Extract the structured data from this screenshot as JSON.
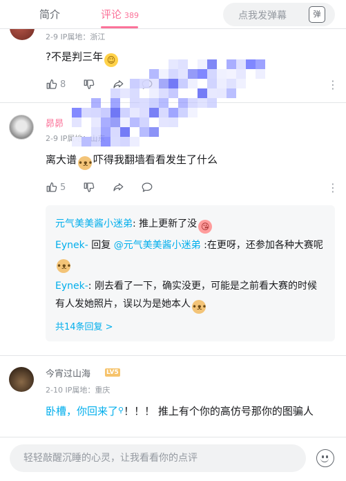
{
  "tabs": {
    "intro": "简介",
    "comments": "评论",
    "comments_count": "389",
    "danmaku_placeholder": "点我发弹幕",
    "danmaku_icon_text": "弹"
  },
  "comments": [
    {
      "meta": "2-9  IP属地：浙江",
      "text": "?不是判三年",
      "emoji": "smile-emoji",
      "likes": "8"
    },
    {
      "username": "昴昴",
      "meta": "2-9  IP属地：山东",
      "text_a": "离大谱",
      "text_b": "吓得我翻墙看看发生了什么",
      "likes": "5",
      "replies": [
        {
          "user": "元气美美酱小迷弟",
          "sep": ": ",
          "text": "推上更新了没"
        },
        {
          "user": "Eynek-",
          "action": " 回复 ",
          "target": "@元气美美酱小迷弟",
          "text": " :在更呀，还参加各种大赛呢"
        },
        {
          "user": "Eynek-",
          "sep": ": ",
          "text": "刚去看了一下，确实没更，可能是之前看大赛的时候有人发她照片，误以为是她本人"
        }
      ],
      "more_replies": "共14条回复 >"
    },
    {
      "username": "今宵过山海",
      "level": "LV5",
      "meta": "2-10  IP属地：重庆",
      "link_text": "卧槽，你回来了",
      "text": "！！！  推上有个你的高仿号那你的图骗人"
    }
  ],
  "bottom": {
    "placeholder": "轻轻敲醒沉睡的心灵，让我看看你的点评"
  },
  "colors": {
    "accent": "#fb7299",
    "link": "#00aeec",
    "muted": "#9499a0"
  }
}
